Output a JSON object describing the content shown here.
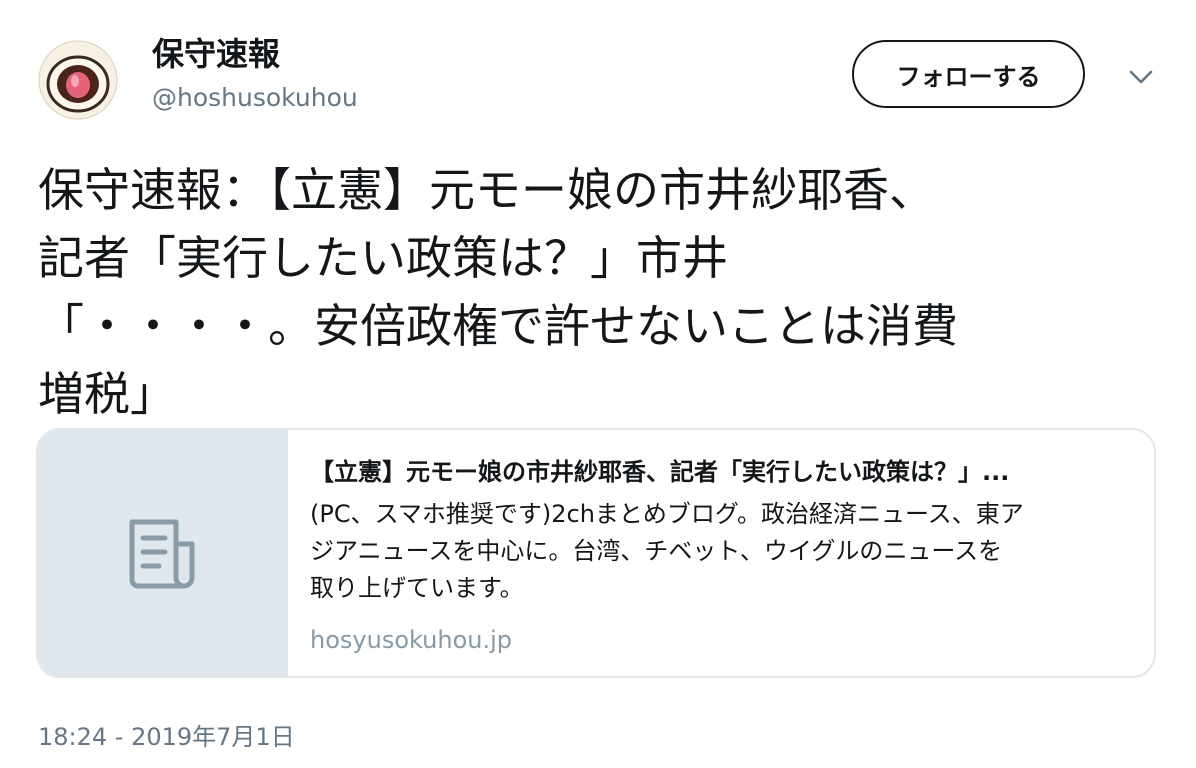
{
  "account": {
    "display_name": "保守速報",
    "handle": "@hoshusokuhou",
    "avatar_icon": "strawberry-daifuku-icon"
  },
  "follow_label": "フォローする",
  "menu_icon": "chevron-down-icon",
  "tweet": {
    "lines": [
      "保守速報：【立憲】元モー娘の市井紗耶香、",
      "記者「実行したい政策は？」市井",
      "「・・・・。安倍政権で許せないことは消費",
      "増税」"
    ]
  },
  "card": {
    "thumb_icon": "document-icon",
    "title": "【立憲】元モー娘の市井紗耶香、記者「実行したい政策は？」...",
    "description_lines": [
      "(PC、スマホ推奨です)2chまとめブログ。政治経済ニュース、東ア",
      "ジアニュースを中心に。台湾、チベット、ウイグルのニュースを",
      "取り上げています。"
    ],
    "domain": "hosyusokuhou.jp"
  },
  "timestamp": "18:24 - 2019年7月1日",
  "colors": {
    "text": "#14171a",
    "secondary": "#657786",
    "card_border": "#e1e8ed",
    "thumb_bg": "#e1e8ed",
    "domain": "#8899a6",
    "icon": "#8a9ba8"
  }
}
